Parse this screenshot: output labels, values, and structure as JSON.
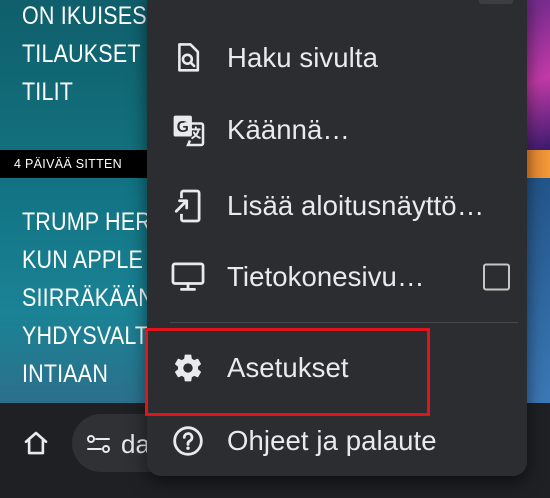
{
  "background": {
    "headline_1": [
      "ON IKUISEST",
      "TILAUKSET -",
      "TILIT"
    ],
    "age_label": "4 PÄIVÄÄ SITTEN",
    "headline_2": [
      "TRUMP HERM",
      "KUN APPLE E",
      "SIIRRÄKÄÄN",
      "YHDYSVALTO",
      "INTIAAN"
    ]
  },
  "bottom_bar": {
    "home_icon": "home-icon",
    "omnibox_text": "da",
    "omnibox_icon": "site-settings-icon"
  },
  "menu": {
    "items": [
      {
        "label": "Haku sivulta",
        "icon": "find-in-page-icon"
      },
      {
        "label": "Käännä…",
        "icon": "translate-icon"
      },
      {
        "label": "Lisää aloitusnäyttö…",
        "icon": "add-to-home-screen-icon"
      },
      {
        "label": "Tietokonesivu…",
        "icon": "desktop-icon",
        "checked": false
      },
      {
        "label": "Asetukset",
        "icon": "gear-icon",
        "highlighted": true
      },
      {
        "label": "Ohjeet ja palaute",
        "icon": "help-icon"
      }
    ]
  },
  "colors": {
    "menu_bg": "#2c2d30",
    "menu_text": "#e8eaed",
    "highlight_border": "#e0141b",
    "card_bg": "#117282"
  }
}
